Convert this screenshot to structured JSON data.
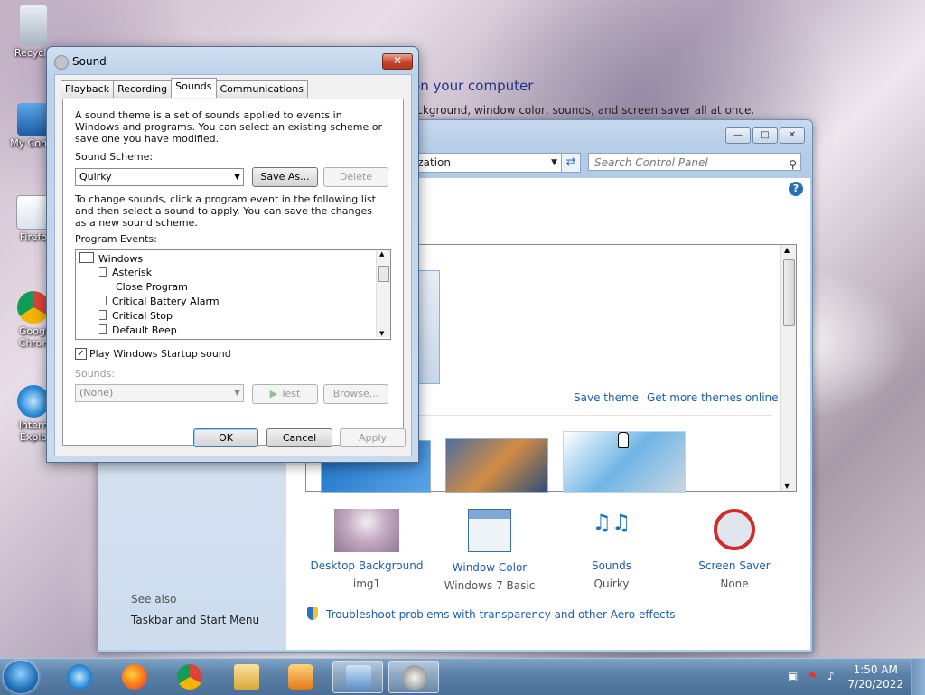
{
  "desktop": {
    "icons": [
      {
        "label": "Recycle",
        "name": "recycle-bin"
      },
      {
        "label": "My Comp",
        "name": "my-computer"
      },
      {
        "label": "Firefo",
        "name": "firefox"
      },
      {
        "label": "Googl Chron",
        "name": "google-chrome"
      },
      {
        "label": "Intern Explo",
        "name": "internet-explorer"
      }
    ]
  },
  "control_panel": {
    "address_text": "ization",
    "search_placeholder": "Search Control Panel",
    "heading": "and sounds on your computer",
    "subtext": "e the desktop background, window color, sounds, and screen saver all at once.",
    "save_theme": "Save theme",
    "get_more_themes": "Get more themes online",
    "bottom_items": [
      {
        "label": "Desktop Background",
        "value": "img1"
      },
      {
        "label": "Window Color",
        "value": "Windows 7 Basic"
      },
      {
        "label": "Sounds",
        "value": "Quirky"
      },
      {
        "label": "Screen Saver",
        "value": "None"
      }
    ],
    "troubleshoot_link": "Troubleshoot problems with transparency and other Aero effects",
    "see_also": "See also",
    "taskbar_link": "Taskbar and Start Menu"
  },
  "sound_dialog": {
    "title": "Sound",
    "tabs": [
      "Playback",
      "Recording",
      "Sounds",
      "Communications"
    ],
    "active_tab": "Sounds",
    "intro": "A sound theme is a set of sounds applied to events in Windows and programs.  You can select an existing scheme or save one you have modified.",
    "scheme_label": "Sound Scheme:",
    "scheme_value": "Quirky",
    "save_as": "Save As...",
    "delete": "Delete",
    "change_text": "To change sounds, click a program event in the following list and then select a sound to apply.  You can save the changes as a new sound scheme.",
    "events_label": "Program Events:",
    "events": [
      "Windows",
      "Asterisk",
      "Close Program",
      "Critical Battery Alarm",
      "Critical Stop",
      "Default Beep"
    ],
    "startup_checkbox": "Play Windows Startup sound",
    "startup_checked": true,
    "sounds_label": "Sounds:",
    "sounds_value": "(None)",
    "test": "Test",
    "browse": "Browse...",
    "ok": "OK",
    "cancel": "Cancel",
    "apply": "Apply"
  },
  "taskbar": {
    "time": "1:50 AM",
    "date": "7/20/2022"
  }
}
